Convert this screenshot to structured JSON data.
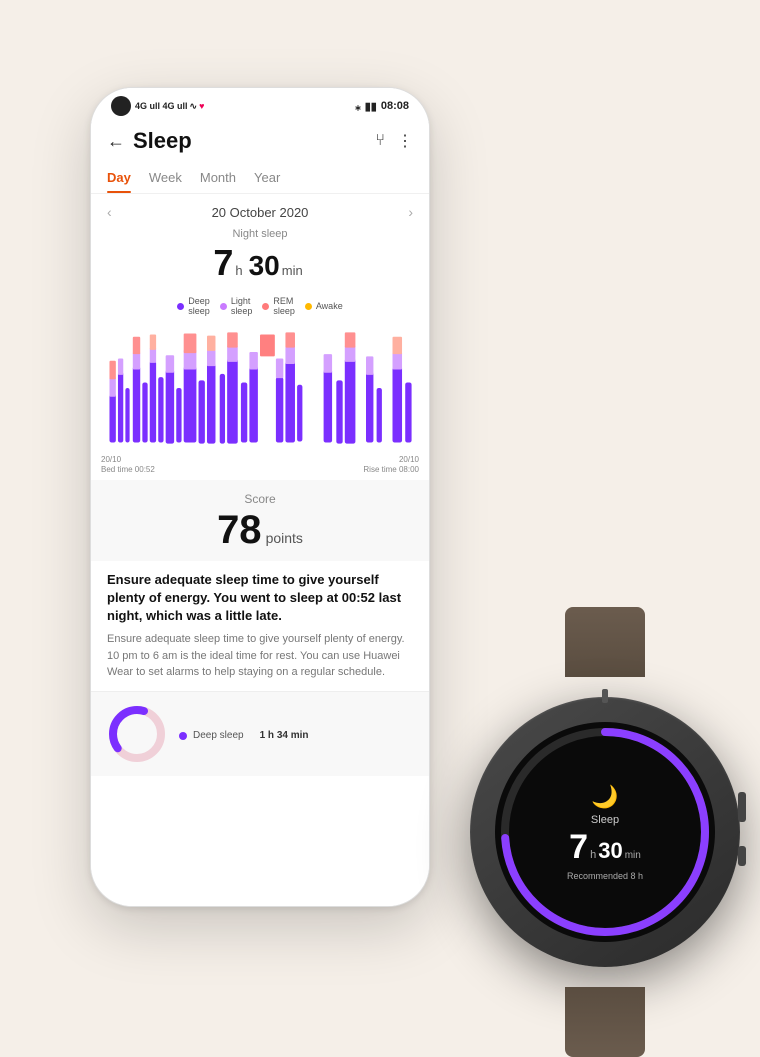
{
  "statusBar": {
    "time": "08:08",
    "battery": "🔋",
    "bluetooth": "⁎"
  },
  "header": {
    "title": "Sleep",
    "backLabel": "←",
    "shareLabel": "⑂",
    "moreLabel": "⋮"
  },
  "tabs": [
    {
      "id": "day",
      "label": "Day",
      "active": true
    },
    {
      "id": "week",
      "label": "Week",
      "active": false
    },
    {
      "id": "month",
      "label": "Month",
      "active": false
    },
    {
      "id": "year",
      "label": "Year",
      "active": false
    }
  ],
  "dateNav": {
    "date": "20 October 2020",
    "prevArrow": "‹",
    "nextArrow": "›"
  },
  "sleepSummary": {
    "label": "Night sleep",
    "hours": "7",
    "hoursUnit": "h",
    "minutes": "30",
    "minutesUnit": "min"
  },
  "legend": [
    {
      "label": "Deep sleep",
      "color": "#7b2fff"
    },
    {
      "label": "Light sleep",
      "color": "#c97bff"
    },
    {
      "label": "REM sleep",
      "color": "#ff7b7b"
    },
    {
      "label": "Awake",
      "color": "#ffb900"
    }
  ],
  "chartLabels": {
    "start": "20/10\nBed time 00:52",
    "end": "20/10\nRise time 08:00"
  },
  "score": {
    "label": "Score",
    "value": "78",
    "unit": "points"
  },
  "adviceBold": "Ensure adequate sleep time to give yourself plenty of energy. You went to sleep at 00:52 last night, which was a little late.",
  "adviceNormal": "Ensure adequate sleep time to give yourself plenty of energy. 10 pm to 6 am is the ideal time for rest. You can use Huawei Wear to set alarms to help staying on a regular schedule.",
  "bottomStats": {
    "stage": "Deep sleep",
    "stageDot": "#7b2fff",
    "stageTime": "1 h 34 min"
  },
  "watch": {
    "sleepLabel": "Sleep",
    "hours": "7",
    "hoursUnit": "h",
    "minutes": "30",
    "minutesUnit": "min",
    "recommended": "Recommended 8 h",
    "moonIcon": "🌙",
    "arcColor": "#8b3fff"
  }
}
